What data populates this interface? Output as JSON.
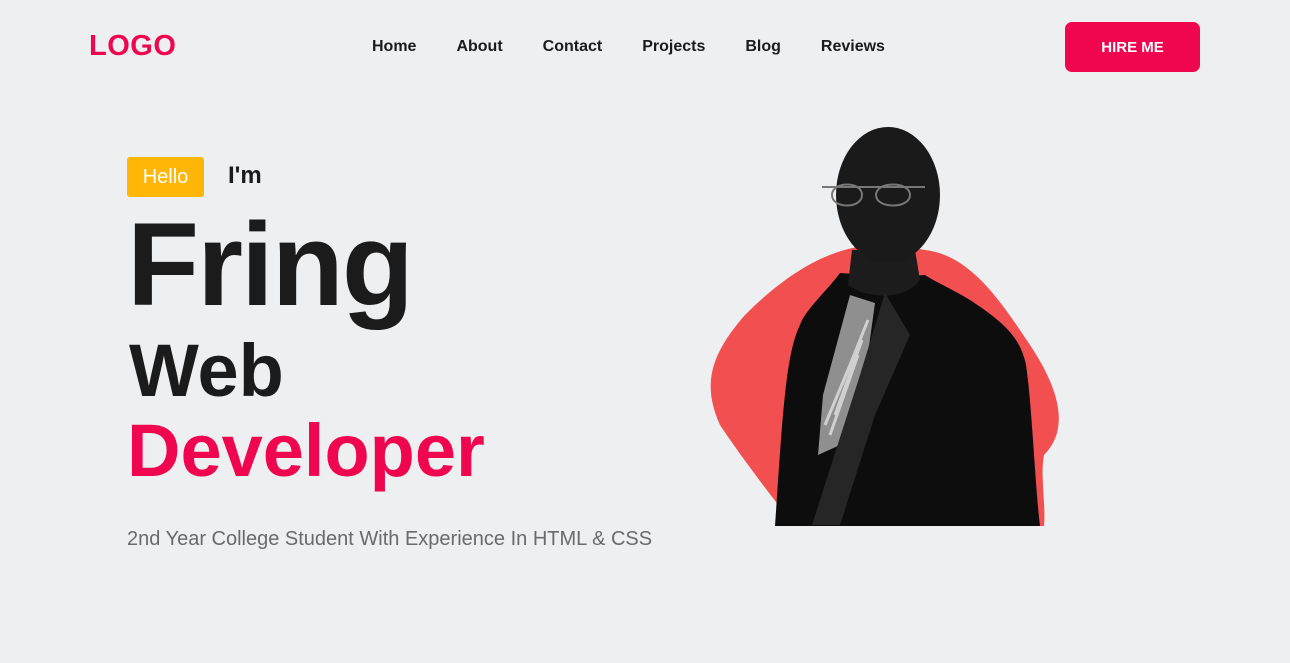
{
  "header": {
    "logo": "LOGO",
    "nav": [
      "Home",
      "About",
      "Contact",
      "Projects",
      "Blog",
      "Reviews"
    ],
    "cta_label": "HIRE ME"
  },
  "hero": {
    "badge": "Hello",
    "intro": "I'm",
    "name": "Fring",
    "role_line1": "Web",
    "role_line2": "Developer",
    "tagline": "2nd Year College Student With Experience In HTML & CSS"
  },
  "colors": {
    "accent": "#f0054f",
    "badge": "#ffb606",
    "blob": "#f24f50",
    "background": "#eeeff1",
    "text": "#1b1b1b"
  }
}
